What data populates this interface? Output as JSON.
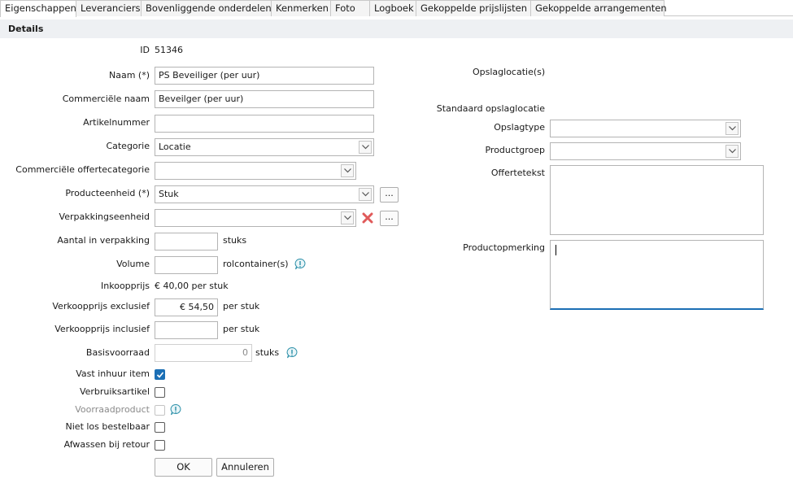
{
  "tabs": [
    {
      "label": "Eigenschappen"
    },
    {
      "label": "Leveranciers"
    },
    {
      "label": "Bovenliggende onderdelen"
    },
    {
      "label": "Kenmerken"
    },
    {
      "label": "Foto"
    },
    {
      "label": "Logboek"
    },
    {
      "label": "Gekoppelde prijslijsten"
    },
    {
      "label": "Gekoppelde arrangementen"
    }
  ],
  "section": {
    "title": "Details"
  },
  "form": {
    "id_label": "ID",
    "id_value": "51346",
    "naam_label": "Naam (*)",
    "naam_value": "PS Beveiliger (per uur)",
    "commerciele_naam_label": "Commerciële naam",
    "commerciele_naam_value": "Beveilger  (per uur)",
    "artikelnummer_label": "Artikelnummer",
    "artikelnummer_value": "",
    "categorie_label": "Categorie",
    "categorie_value": "Locatie",
    "offertecategorie_label": "Commerciële offertecategorie",
    "offertecategorie_value": "",
    "producteenheid_label": "Producteenheid (*)",
    "producteenheid_value": "Stuk",
    "verpakkingseenheid_label": "Verpakkingseenheid",
    "verpakkingseenheid_value": "",
    "aantal_label": "Aantal in verpakking",
    "aantal_value": "",
    "aantal_unit": "stuks",
    "volume_label": "Volume",
    "volume_value": "",
    "volume_unit": "rolcontainer(s)",
    "inkoopprijs_label": "Inkoopprijs",
    "inkoopprijs_value": "€ 40,00 per stuk",
    "verkoop_excl_label": "Verkoopprijs exclusief",
    "verkoop_excl_value": "€ 54,50",
    "verkoop_excl_unit": "per stuk",
    "verkoop_incl_label": "Verkoopprijs inclusief",
    "verkoop_incl_value": "",
    "verkoop_incl_unit": "per stuk",
    "basisvoorraad_label": "Basisvoorraad",
    "basisvoorraad_value": "0",
    "basisvoorraad_unit": "stuks",
    "vast_inhuur_label": "Vast inhuur item",
    "vast_inhuur_checked": true,
    "verbruiksartikel_label": "Verbruiksartikel",
    "verbruiksartikel_checked": false,
    "voorraadproduct_label": "Voorraadproduct",
    "voorraadproduct_checked": false,
    "niet_los_label": "Niet los bestelbaar",
    "niet_los_checked": false,
    "afwassen_label": "Afwassen bij retour",
    "afwassen_checked": false,
    "ellipsis": "...",
    "ok_label": "OK",
    "cancel_label": "Annuleren"
  },
  "right": {
    "opslaglocaties_label": "Opslaglocatie(s)",
    "standaard_label": "Standaard opslaglocatie",
    "opslagtype_label": "Opslagtype",
    "opslagtype_value": "",
    "productgroep_label": "Productgroep",
    "productgroep_value": "",
    "offertetekst_label": "Offertetekst",
    "productopmerking_label": "Productopmerking"
  },
  "colors": {
    "accent": "#1b6fb5",
    "delete": "#e05a5a",
    "info": "#2a8fa8"
  },
  "icons": {
    "dropdown": "chevron-down-icon",
    "info": "info-icon",
    "delete": "delete-x-icon",
    "check": "checkmark-icon"
  }
}
